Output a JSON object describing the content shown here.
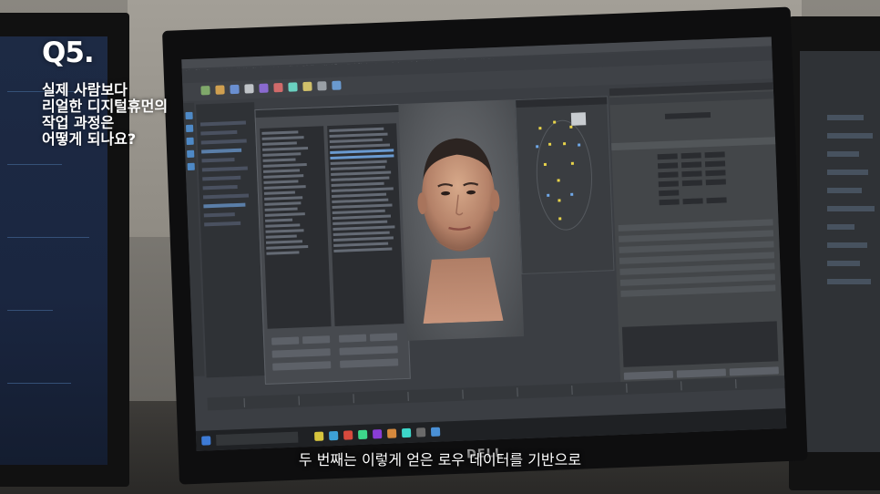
{
  "overlay": {
    "badge": "Q5.",
    "title_lines": [
      "실제 사람보다",
      "리얼한 디지털휴먼의",
      "작업 과정은",
      "어떻게 되나요?"
    ],
    "subtitle": "두 번째는 이렇게 얻은 로우 데이터를 기반으로"
  },
  "monitor": {
    "brand": "DELL"
  },
  "icons": [
    "maya-menu-icon",
    "face-3d-model",
    "windows-taskbar-icon"
  ]
}
